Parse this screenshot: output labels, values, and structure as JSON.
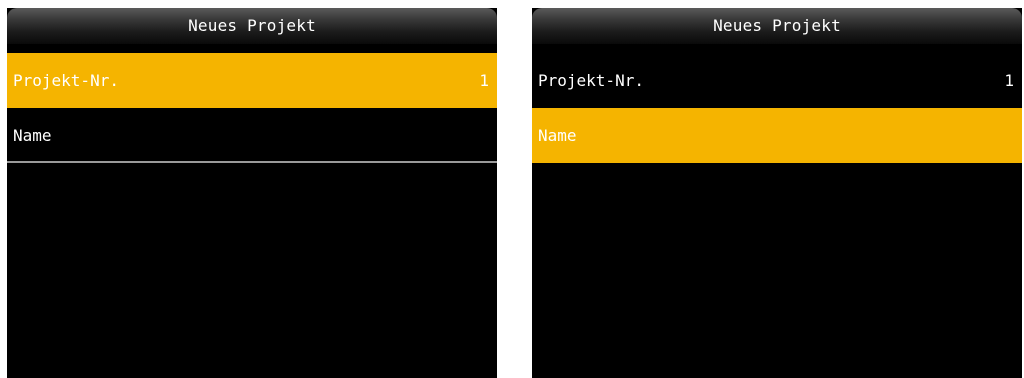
{
  "left_screen": {
    "title": "Neues Projekt",
    "items": [
      {
        "label": "Projekt-Nr.",
        "value": "1",
        "selected": true
      },
      {
        "label": "Name",
        "value": "",
        "selected": false
      }
    ]
  },
  "right_screen": {
    "title": "Neues Projekt",
    "items": [
      {
        "label": "Projekt-Nr.",
        "value": "1",
        "selected": false
      },
      {
        "label": "Name",
        "value": "",
        "selected": true
      }
    ]
  },
  "colors": {
    "highlight": "#f5b400",
    "background": "#000000",
    "text": "#ffffff",
    "divider": "#9a9a9a"
  }
}
